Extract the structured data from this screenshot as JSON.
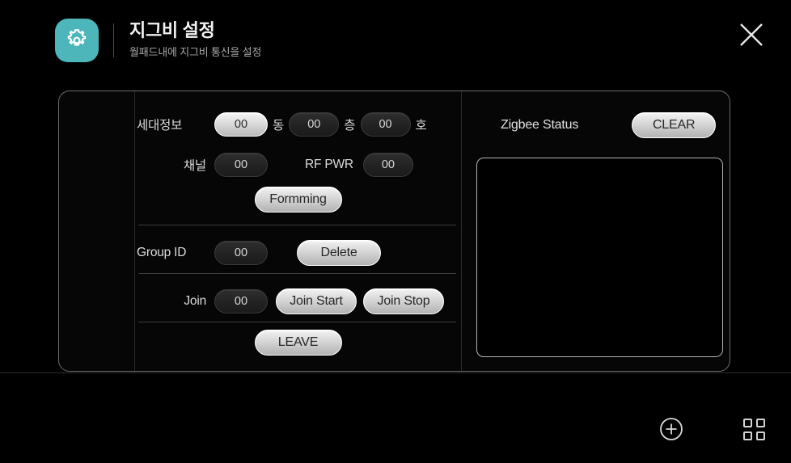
{
  "header": {
    "icon": "gear-icon",
    "title": "지그비 설정",
    "subtitle": "월패드내에 지그비 통신을 설정",
    "close_icon": "close-icon",
    "accent_color": "#4cb6bb"
  },
  "form": {
    "household": {
      "label": "세대정보",
      "building": {
        "value": "00",
        "unit": "동",
        "focused": true
      },
      "floor": {
        "value": "00",
        "unit": "층",
        "focused": false
      },
      "unit_no": {
        "value": "00",
        "unit": "호",
        "focused": false
      }
    },
    "channel": {
      "label": "채널",
      "value": "00",
      "rf_pwr_label": "RF PWR",
      "rf_pwr_value": "00"
    },
    "forming_button": "Formming",
    "group": {
      "label": "Group ID",
      "value": "00",
      "delete_button": "Delete"
    },
    "join": {
      "label": "Join",
      "value": "00",
      "start_button": "Join Start",
      "stop_button": "Join Stop"
    },
    "leave_button": "LEAVE"
  },
  "status": {
    "label": "Zigbee Status",
    "clear_button": "CLEAR",
    "log_text": ""
  },
  "bottom_bar": {
    "add_icon": "plus-circle-icon",
    "apps_icon": "grid-apps-icon"
  }
}
